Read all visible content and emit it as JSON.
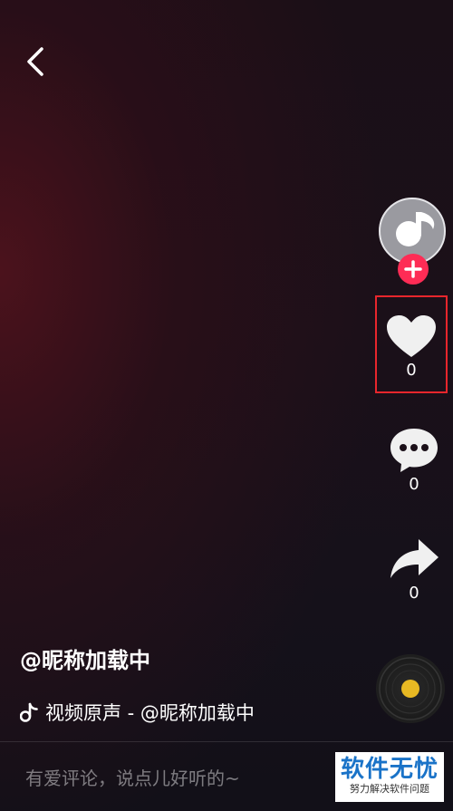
{
  "header": {
    "back_icon": "chevron-left-icon"
  },
  "sidebar": {
    "avatar_icon": "music-note-avatar-icon",
    "follow_icon": "plus-icon",
    "like": {
      "icon": "heart-icon",
      "count": "0"
    },
    "comment": {
      "icon": "comment-bubble-icon",
      "count": "0"
    },
    "share": {
      "icon": "share-arrow-icon",
      "count": "0"
    },
    "music_disc_icon": "vinyl-disc-icon"
  },
  "video_info": {
    "author": "@昵称加载中",
    "music_icon": "tiktok-note-icon",
    "music_text": "视频原声 - @昵称加载中"
  },
  "comment_bar": {
    "placeholder": "有爱评论，说点儿好听的~"
  },
  "watermark": {
    "main": "软件无忧",
    "sub": "努力解决软件问题"
  },
  "colors": {
    "accent_red": "#fe2c55",
    "highlight_box": "#e8262c",
    "disc_center": "#e8b923",
    "watermark_blue": "#1a73c8"
  }
}
